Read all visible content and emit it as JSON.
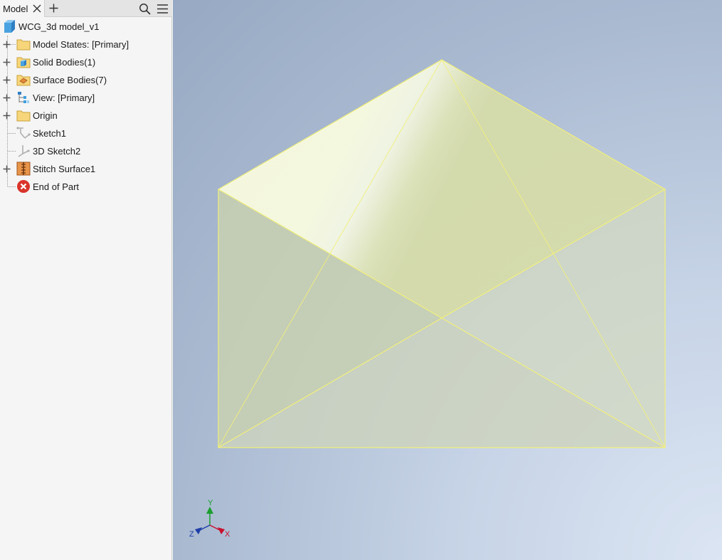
{
  "browser": {
    "tab_label": "Model",
    "root": "WCG_3d model_v1",
    "items": [
      {
        "label": "Model States: [Primary]"
      },
      {
        "label": "Solid Bodies(1)"
      },
      {
        "label": "Surface Bodies(7)"
      },
      {
        "label": "View: [Primary]"
      },
      {
        "label": "Origin"
      },
      {
        "label": "Sketch1"
      },
      {
        "label": "3D Sketch2"
      },
      {
        "label": "Stitch Surface1"
      },
      {
        "label": "End of Part"
      }
    ]
  },
  "triad": {
    "x": "X",
    "y": "Y",
    "z": "Z"
  },
  "colors": {
    "x_axis": "#c8102e",
    "y_axis": "#1a9e2e",
    "z_axis": "#1f3fa8",
    "edge": "#f2f07a"
  }
}
